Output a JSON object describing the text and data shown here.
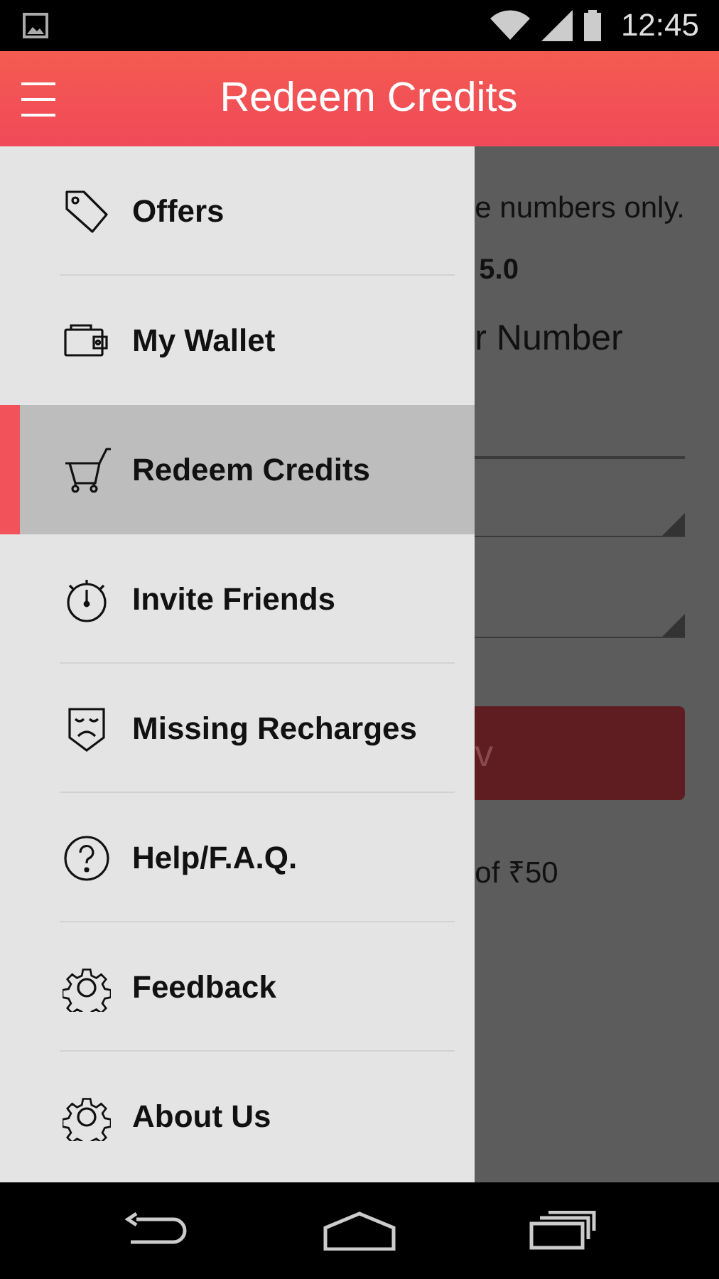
{
  "status_bar": {
    "time": "12:45"
  },
  "app_bar": {
    "title": "Redeem Credits"
  },
  "drawer": {
    "items": [
      {
        "label": "Offers",
        "kind": "tag",
        "selected": false
      },
      {
        "label": "My Wallet",
        "kind": "wallet",
        "selected": false
      },
      {
        "label": "Redeem Credits",
        "kind": "cart",
        "selected": true
      },
      {
        "label": "Invite Friends",
        "kind": "stopwatch",
        "selected": false
      },
      {
        "label": "Missing Recharges",
        "kind": "mask",
        "selected": false
      },
      {
        "label": "Help/F.A.Q.",
        "kind": "help",
        "selected": false
      },
      {
        "label": "Feedback",
        "kind": "gear",
        "selected": false
      },
      {
        "label": "About Us",
        "kind": "gear",
        "selected": false
      }
    ]
  },
  "background": {
    "note": "e numbers only.",
    "balance": "5.0",
    "heading": "r Number",
    "button": "v",
    "footer": "of ₹50"
  }
}
